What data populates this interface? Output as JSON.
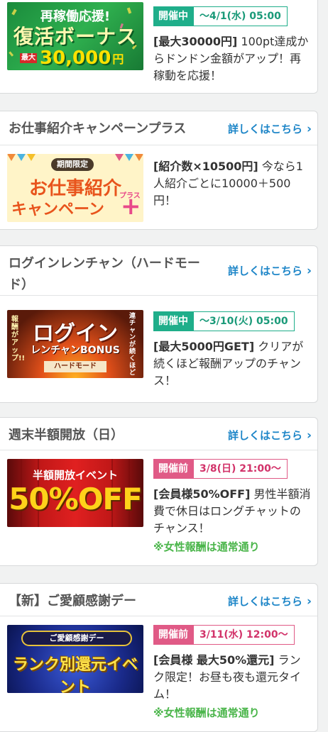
{
  "cards": [
    {
      "title": "",
      "banner": {
        "line1": "再稼働応援!",
        "line2": "復活ボーナス",
        "small": "最大",
        "amount": "30,000",
        "unit": "円"
      },
      "status": "開催中",
      "period": "～4/1(水) 05:00",
      "highlight": "[最大30000円]",
      "desc": " 100pt達成からドンドン金額がアップ！再稼動を応援！"
    },
    {
      "title": "お仕事紹介キャンペーンプラス",
      "link": "詳しくはこちら",
      "banner": {
        "tag": "期間限定",
        "line1": "お仕事紹介",
        "line2": "キャンペーン",
        "plus": "プラス"
      },
      "highlight": "[紹介数×10500円]",
      "desc": " 今なら1人紹介ごとに10000＋500円！"
    },
    {
      "title": "ログインレンチャン（ハードモード）",
      "link": "詳しくはこちら",
      "banner": {
        "main": "ログイン",
        "sub": "レンチャンBONUS",
        "mode": "ハードモード",
        "left": "報酬がアップ!!",
        "right": "連チャンが続くほど"
      },
      "status": "開催中",
      "period": "～3/10(火) 05:00",
      "highlight": "[最大5000円GET]",
      "desc": " クリアが続くほど報酬アップのチャンス！"
    },
    {
      "title": "週末半額開放（日）",
      "link": "詳しくはこちら",
      "banner": {
        "line1": "半額開放イベント",
        "line2": "50%OFF"
      },
      "status": "開催前",
      "period": "3/8(日) 21:00～",
      "highlight": "[会員様50%OFF]",
      "desc": " 男性半額消費で休日はロングチャットのチャンス！",
      "note": "※女性報酬は通常通り"
    },
    {
      "title": "【新】ご愛顧感謝デー",
      "link": "詳しくはこちら",
      "banner": {
        "line1": "ご愛顧感謝デー",
        "line2": "ランク別還元イベント"
      },
      "status": "開催前",
      "period": "3/11(水) 12:00～",
      "highlight": "[会員様 最大50%還元]",
      "desc": " ランク限定！お昼も夜も還元タイム！",
      "note": "※女性報酬は通常通り"
    }
  ]
}
